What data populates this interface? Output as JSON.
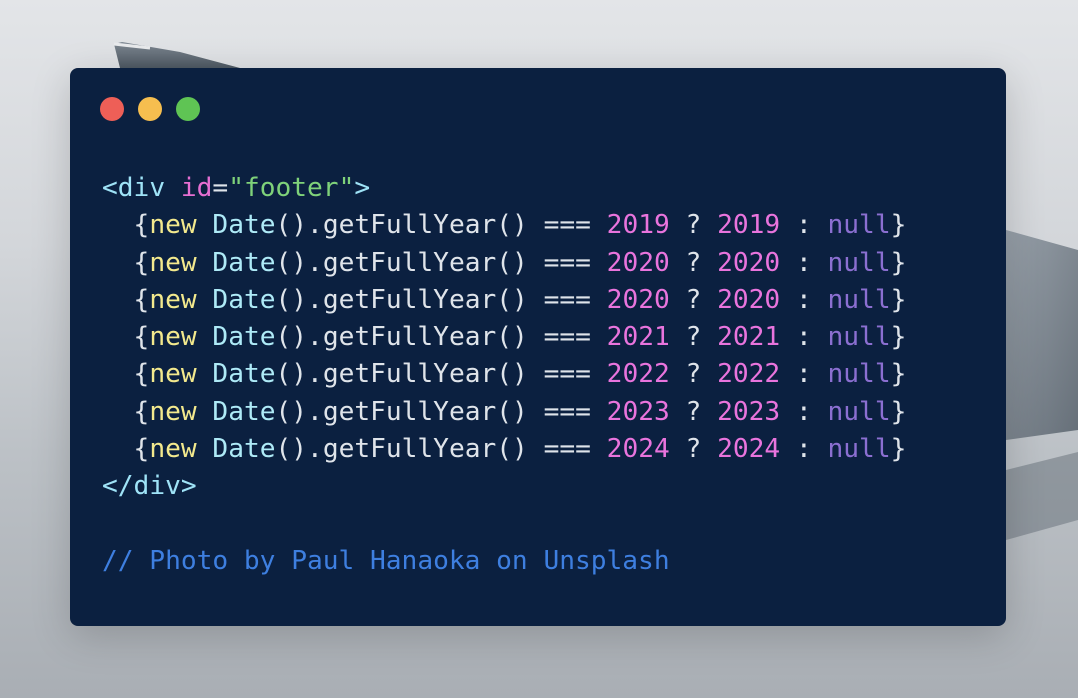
{
  "window": {
    "title_dots": [
      {
        "name": "close",
        "color": "#ee5f57"
      },
      {
        "name": "minimize",
        "color": "#f6be4f"
      },
      {
        "name": "maximize",
        "color": "#5fc454"
      }
    ]
  },
  "code": {
    "open_tag": {
      "lt": "<",
      "tag": "div",
      "attr": "id",
      "eq": "=",
      "value": "\"footer\"",
      "gt": ">"
    },
    "body_lines": [
      {
        "indent": "  ",
        "open_brace": "{",
        "kw_new": "new",
        "cls": "Date",
        "paren_pair": "()",
        "method": ".getFullYear",
        "paren_pair2": "()",
        "op": "===",
        "year": "2019",
        "q": "?",
        "year2": "2019",
        "colon": ":",
        "null": "null",
        "close_brace": "}"
      },
      {
        "indent": "  ",
        "open_brace": "{",
        "kw_new": "new",
        "cls": "Date",
        "paren_pair": "()",
        "method": ".getFullYear",
        "paren_pair2": "()",
        "op": "===",
        "year": "2020",
        "q": "?",
        "year2": "2020",
        "colon": ":",
        "null": "null",
        "close_brace": "}"
      },
      {
        "indent": "  ",
        "open_brace": "{",
        "kw_new": "new",
        "cls": "Date",
        "paren_pair": "()",
        "method": ".getFullYear",
        "paren_pair2": "()",
        "op": "===",
        "year": "2020",
        "q": "?",
        "year2": "2020",
        "colon": ":",
        "null": "null",
        "close_brace": "}"
      },
      {
        "indent": "  ",
        "open_brace": "{",
        "kw_new": "new",
        "cls": "Date",
        "paren_pair": "()",
        "method": ".getFullYear",
        "paren_pair2": "()",
        "op": "===",
        "year": "2021",
        "q": "?",
        "year2": "2021",
        "colon": ":",
        "null": "null",
        "close_brace": "}"
      },
      {
        "indent": "  ",
        "open_brace": "{",
        "kw_new": "new",
        "cls": "Date",
        "paren_pair": "()",
        "method": ".getFullYear",
        "paren_pair2": "()",
        "op": "===",
        "year": "2022",
        "q": "?",
        "year2": "2022",
        "colon": ":",
        "null": "null",
        "close_brace": "}"
      },
      {
        "indent": "  ",
        "open_brace": "{",
        "kw_new": "new",
        "cls": "Date",
        "paren_pair": "()",
        "method": ".getFullYear",
        "paren_pair2": "()",
        "op": "===",
        "year": "2023",
        "q": "?",
        "year2": "2023",
        "colon": ":",
        "null": "null",
        "close_brace": "}"
      },
      {
        "indent": "  ",
        "open_brace": "{",
        "kw_new": "new",
        "cls": "Date",
        "paren_pair": "()",
        "method": ".getFullYear",
        "paren_pair2": "()",
        "op": "===",
        "year": "2024",
        "q": "?",
        "year2": "2024",
        "colon": ":",
        "null": "null",
        "close_brace": "}"
      }
    ],
    "close_tag": {
      "lt": "</",
      "tag": "div",
      "gt": ">"
    },
    "comment": "// Photo by Paul Hanaoka on Unsplash"
  },
  "colors": {
    "window_bg": "#0b2040",
    "punct": "#9fe3f7",
    "attr": "#e66fd2",
    "string": "#7fd27a",
    "brace": "#dfe4ea",
    "keyword": "#f3e98d",
    "class_name": "#aeeaf7",
    "method": "#dfe4ea",
    "number": "#e974dd",
    "null_kw": "#8b6fd1",
    "comment": "#3e7fe0"
  }
}
